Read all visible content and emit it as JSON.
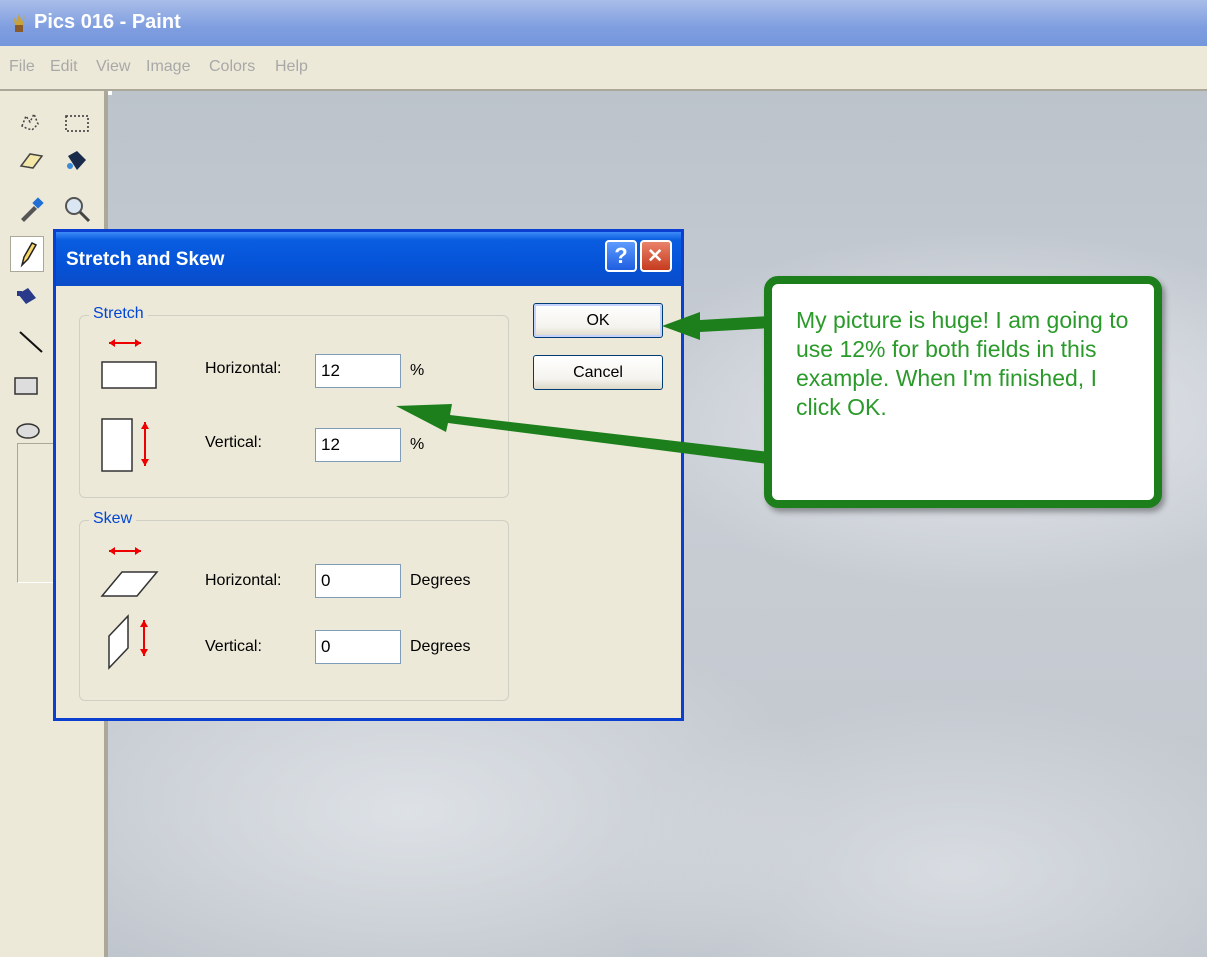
{
  "window": {
    "title": "Pics 016 - Paint"
  },
  "menu": [
    "File",
    "Edit",
    "View",
    "Image",
    "Colors",
    "Help"
  ],
  "toolbox": {
    "tools": [
      "free-form-select-icon",
      "select-icon",
      "eraser-icon",
      "fill-icon",
      "color-picker-icon",
      "magnifier-icon",
      "pencil-icon",
      "brush-icon",
      "line-icon",
      "rectangle-icon",
      "ellipse-icon"
    ],
    "selected": "pencil-icon"
  },
  "dialog": {
    "title": "Stretch and Skew",
    "help_label": "?",
    "stretch": {
      "label": "Stretch",
      "horizontal_label": "Horizontal:",
      "horizontal_value": "12",
      "horizontal_unit": "%",
      "vertical_label": "Vertical:",
      "vertical_value": "12",
      "vertical_unit": "%"
    },
    "skew": {
      "label": "Skew",
      "horizontal_label": "Horizontal:",
      "horizontal_value": "0",
      "horizontal_unit": "Degrees",
      "vertical_label": "Vertical:",
      "vertical_value": "0",
      "vertical_unit": "Degrees"
    },
    "ok_label": "OK",
    "cancel_label": "Cancel"
  },
  "callout": {
    "text": "My picture is huge!  I am going to use 12% for both fields in this example.  When I'm finished, I click OK."
  },
  "colors": {
    "title_bar": "#7f9ee0",
    "dialog_title": "#0553d8",
    "callout_border": "#1c7f1c",
    "callout_text": "#2a9a2a"
  }
}
